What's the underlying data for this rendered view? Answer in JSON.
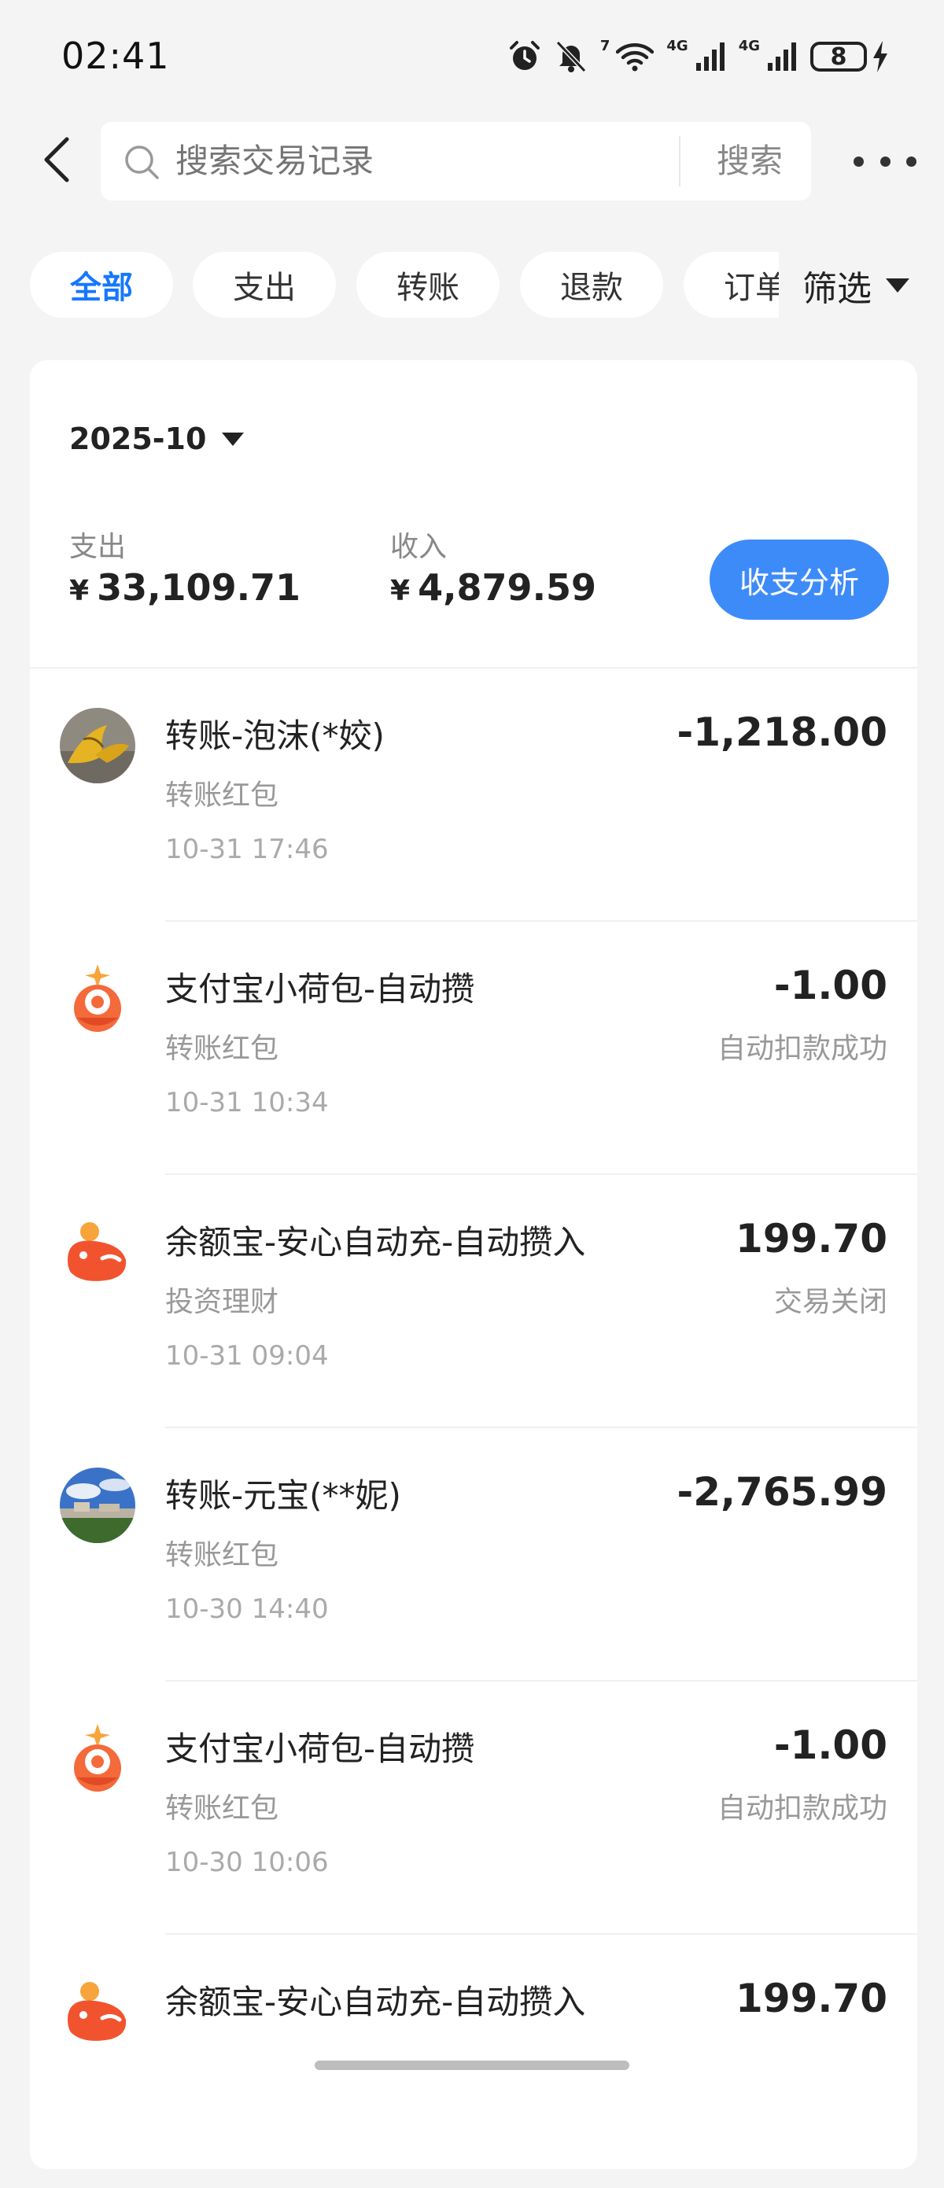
{
  "status_bar": {
    "time": "02:41",
    "battery": "8",
    "network_1": "4G",
    "network_2": "4G",
    "wifi_label": "7"
  },
  "header": {
    "search_placeholder": "搜索交易记录",
    "search_button": "搜索"
  },
  "filters": {
    "chips": [
      "全部",
      "支出",
      "转账",
      "退款",
      "订单"
    ],
    "active": "全部",
    "filter_button": "筛选"
  },
  "summary": {
    "month": "2025-10",
    "expense_label": "支出",
    "expense_value": "33,109.71",
    "income_label": "收入",
    "income_value": "4,879.59",
    "currency": "¥",
    "analysis_button": "收支分析"
  },
  "transactions": [
    {
      "title": "转账-泡沫(*姣)",
      "category": "转账红包",
      "time": "10-31 17:46",
      "amount": "-1,218.00",
      "status": "",
      "icon": "banana-photo-avatar"
    },
    {
      "title": "支付宝小荷包-自动攒",
      "category": "转账红包",
      "time": "10-31 10:34",
      "amount": "-1.00",
      "status": "自动扣款成功",
      "icon": "alipay-pocket-icon"
    },
    {
      "title": "余额宝-安心自动充-自动攒入",
      "category": "投资理财",
      "time": "10-31 09:04",
      "amount": "199.70",
      "status": "交易关闭",
      "icon": "yuebao-icon"
    },
    {
      "title": "转账-元宝(**妮)",
      "category": "转账红包",
      "time": "10-30 14:40",
      "amount": "-2,765.99",
      "status": "",
      "icon": "landscape-photo-avatar"
    },
    {
      "title": "支付宝小荷包-自动攒",
      "category": "转账红包",
      "time": "10-30 10:06",
      "amount": "-1.00",
      "status": "自动扣款成功",
      "icon": "alipay-pocket-icon"
    },
    {
      "title": "余额宝-安心自动充-自动攒入",
      "category": "",
      "time": "",
      "amount": "199.70",
      "status": "",
      "icon": "yuebao-icon"
    }
  ],
  "colors": {
    "accent": "#1677ff",
    "button": "#3d8bf8",
    "background": "#f4f4f4",
    "orange": "#f26a2e"
  }
}
